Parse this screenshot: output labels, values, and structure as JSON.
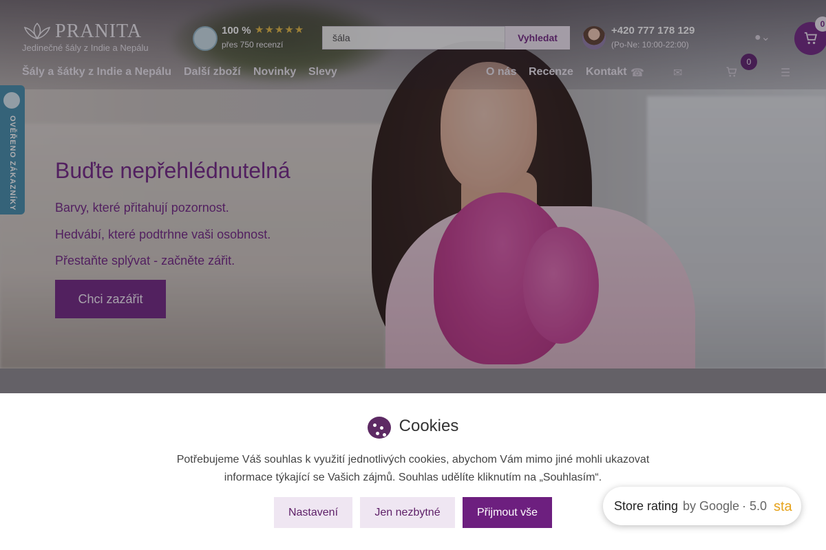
{
  "header": {
    "brand": "PRANITA",
    "tagline": "Jedinečné šály z Indie a Nepálu",
    "rating_percent": "100 %",
    "rating_stars": "★★★★★",
    "rating_count": "přes 750 recenzí",
    "search_value": "šála",
    "search_button": "Vyhledat",
    "phone": "+420 777 178 129",
    "hours": "(Po-Ne: 10:00-22:00)",
    "cart_count": "0",
    "cart_count_small": "0"
  },
  "nav": {
    "items": [
      "Šály a šátky z Indie a Nepálu",
      "Další zboží",
      "Novinky",
      "Slevy"
    ],
    "right_items": [
      "O nás",
      "Recenze",
      "Kontakt"
    ]
  },
  "sidetab": {
    "label": "OVĚŘENO ZÁKAZNÍKY"
  },
  "hero": {
    "headline": "Buďte nepřehlédnutelná",
    "lines": [
      "Barvy, které přitahují pozornost.",
      "Hedvábí, které podtrhne vaši osobnost.",
      "Přestaňte splývat - začněte zářit."
    ],
    "cta": "Chci zazářit"
  },
  "cookies": {
    "title": "Cookies",
    "message": "Potřebujeme Váš souhlas k využití jednotlivých cookies, abychom Vám mimo jiné mohli ukazovat informace týkající se Vašich zájmů. Souhlas udělíte kliknutím na „Souhlasím“.",
    "btn_settings": "Nastavení",
    "btn_necessary": "Jen nezbytné",
    "btn_accept": "Přijmout vše"
  },
  "store_rating": {
    "label": "Store rating",
    "by": "by Google",
    "score": "5.0",
    "extra": "sta"
  },
  "colors": {
    "accent": "#6d1f7f",
    "accent_light": "#efe6f2",
    "verified": "#3e8aa8"
  },
  "icons": [
    "user-icon",
    "cart-icon",
    "phone-icon",
    "mail-icon",
    "menu-icon",
    "cookie-icon",
    "star-icon"
  ]
}
